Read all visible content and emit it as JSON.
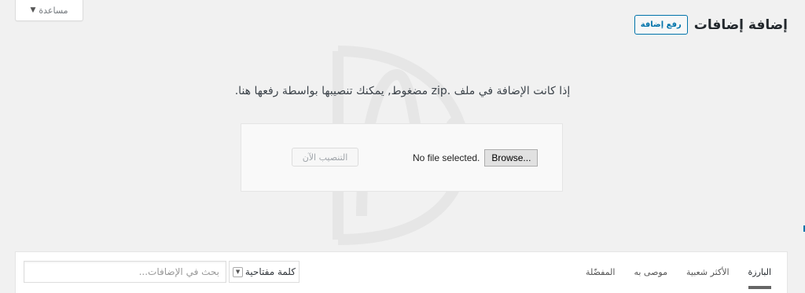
{
  "help_tab": {
    "label": "مساعدة",
    "arrow": "▼"
  },
  "header": {
    "title": "إضافة إضافات",
    "upload_button": "رفع إضافة"
  },
  "upload": {
    "instruction": "إذا كانت الإضافة في ملف .zip مضغوط, يمكنك تنصيبها بواسطة رفعها هنا.",
    "browse_label": "Browse...",
    "no_file": "No file selected.",
    "install_label": "التنصيب الآن"
  },
  "filter": {
    "tabs": [
      {
        "label": "البارزة",
        "current": true
      },
      {
        "label": "الأكثر شعبية",
        "current": false
      },
      {
        "label": "موصى به",
        "current": false
      },
      {
        "label": "المفضّلة",
        "current": false
      }
    ],
    "search_type": "كلمة مفتاحية",
    "search_placeholder": "بحث في الإضافات..."
  },
  "colors": {
    "accent": "#0073aa",
    "background": "#f1f1f1"
  }
}
